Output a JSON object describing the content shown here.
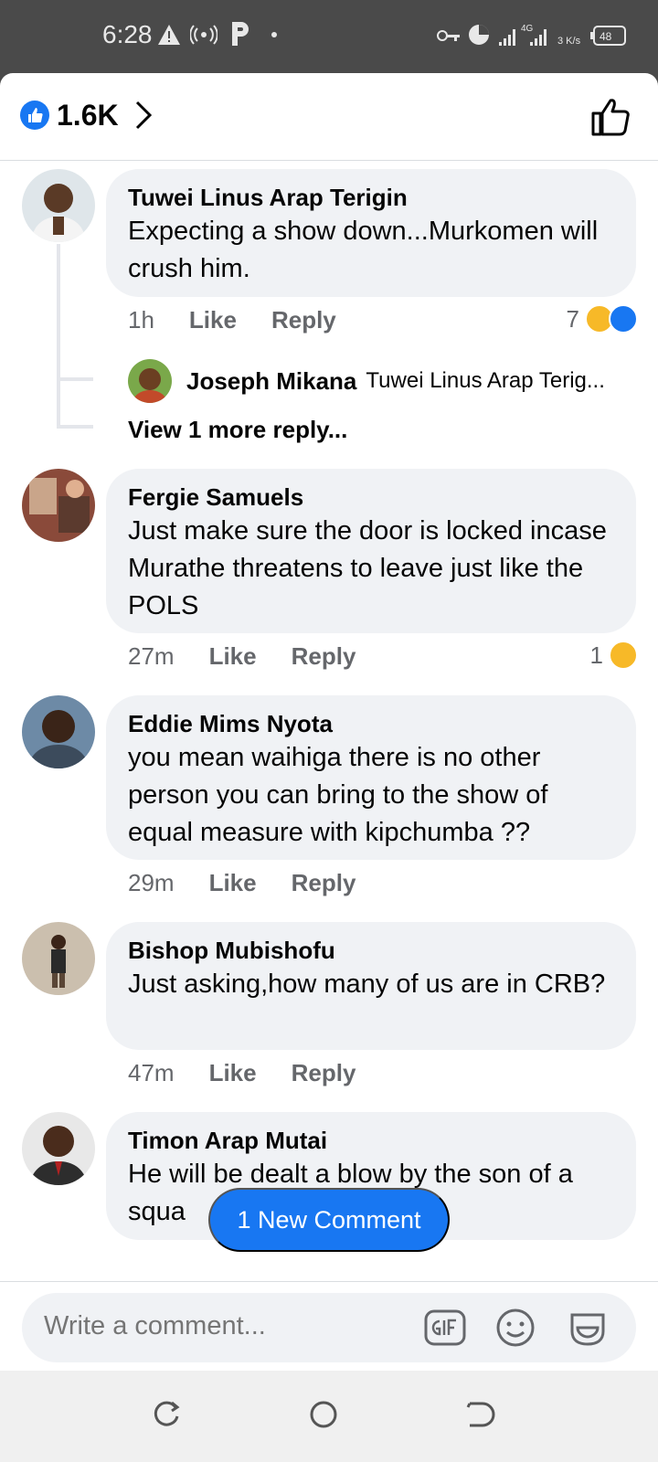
{
  "status_bar": {
    "time": "6:28",
    "network": "4G",
    "speed": "3 K/s",
    "battery": "48"
  },
  "header": {
    "like_count": "1.6K"
  },
  "comments": [
    {
      "name": "Tuwei Linus Arap Terigin",
      "text": "Expecting a show down...Murkomen will crush him.",
      "time": "1h",
      "like": "Like",
      "reply": "Reply",
      "reactions": "7"
    },
    {
      "name": "Fergie Samuels",
      "text": "Just make sure the door is locked incase Murathe threatens to leave just like the POLS",
      "time": "27m",
      "like": "Like",
      "reply": "Reply",
      "reactions": "1"
    },
    {
      "name": "Eddie Mims Nyota",
      "text": "you mean waihiga there is no other person you can bring to the show of equal measure with kipchumba ??",
      "time": "29m",
      "like": "Like",
      "reply": "Reply"
    },
    {
      "name": "Bishop Mubishofu",
      "text": "Just asking,how many of us are in CRB?",
      "time": "47m",
      "like": "Like",
      "reply": "Reply"
    },
    {
      "name": "Timon Arap Mutai",
      "text": "He will be dealt a blow by the son of a squa"
    }
  ],
  "reply_preview": {
    "name": "Joseph Mikana",
    "text": "Tuwei Linus Arap Terig..."
  },
  "view_more": "View 1 more reply...",
  "new_comment_pill": "1 New Comment",
  "composer": {
    "placeholder": "Write a comment..."
  },
  "colors": {
    "accent": "#1877f2",
    "bubble": "#f0f2f5",
    "muted": "#65676b"
  }
}
